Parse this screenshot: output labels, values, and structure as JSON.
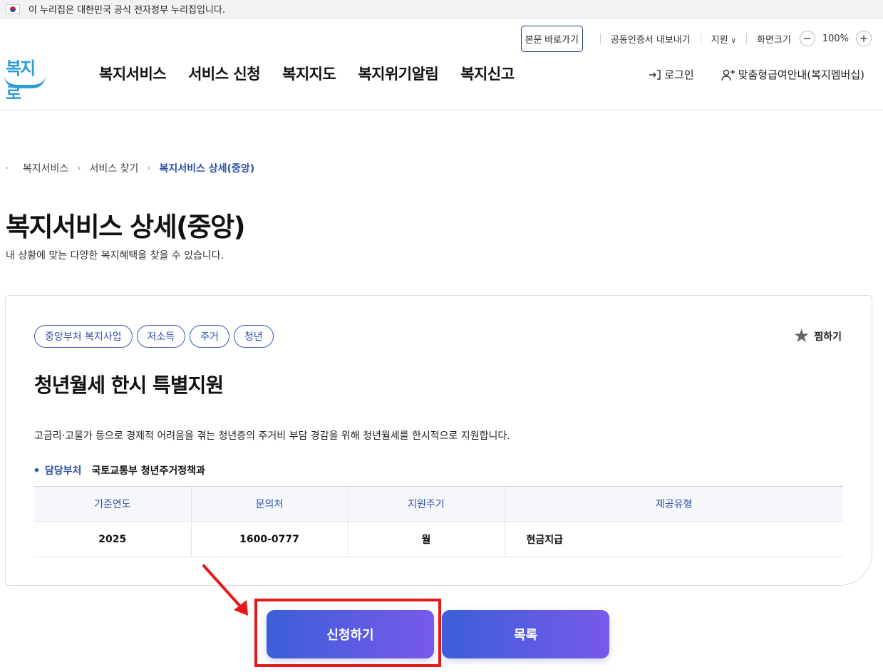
{
  "gov_banner": {
    "text": "이 누리집은 대한민국 공식 전자정부 누리집입니다."
  },
  "utility": {
    "skip_label": "본문 바로가기",
    "cert_label": "공동인증서 내보내기",
    "support_label": "지원",
    "zoom_label": "화면크기",
    "zoom_value": "100%",
    "zoom_out": "−",
    "zoom_in": "+"
  },
  "header": {
    "logo_text": "복지로",
    "nav": [
      "복지서비스",
      "서비스 신청",
      "복지지도",
      "복지위기알림",
      "복지신고"
    ],
    "login_label": "로그인",
    "member_label": "맞춤형급여안내(복지멤버십)"
  },
  "breadcrumb": [
    "복지서비스",
    "서비스 찾기",
    "복지서비스 상세(중앙)"
  ],
  "page": {
    "title": "복지서비스 상세(중앙)",
    "description": "내 상황에 맞는 다양한 복지혜택을 찾을 수 있습니다."
  },
  "service": {
    "tags": [
      "중앙부처 복지사업",
      "저소득",
      "주거",
      "청년"
    ],
    "favorite_label": "찜하기",
    "title": "청년월세 한시 특별지원",
    "description": "고금리·고물가 등으로 경제적 어려움을 겪는 청년층의 주거비 부담 경감을 위해 청년월세를 한시적으로 지원합니다.",
    "dept_label": "담당부처",
    "dept_value": "국토교통부 청년주거정책과",
    "table": {
      "headers": [
        "기준연도",
        "문의처",
        "지원주기",
        "제공유형"
      ],
      "row": [
        "2025",
        "1600-0777",
        "월",
        "현금지급"
      ]
    }
  },
  "actions": {
    "apply_label": "신청하기",
    "list_label": "목록"
  },
  "colors": {
    "accent": "#2c4fa8",
    "button_start": "#3c5fd9",
    "button_end": "#7759ea",
    "annotation": "#e81818"
  }
}
